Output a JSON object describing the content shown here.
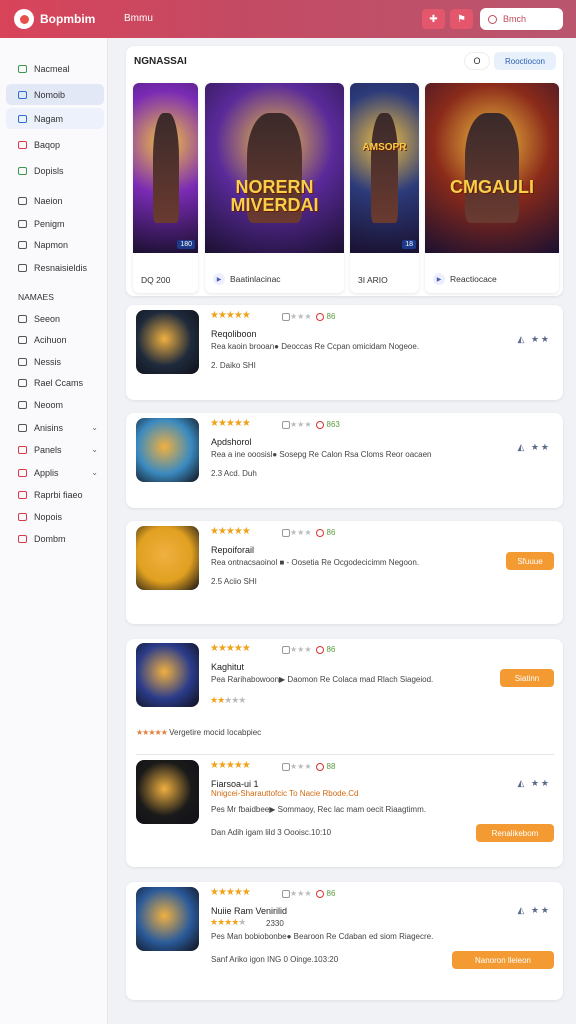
{
  "topbar": {
    "app_title": "Bopmbim",
    "nav_title": "Bmmu",
    "search_label": "Bmch",
    "logo_icon": "logo-icon",
    "btn1_icon": "gamepad-icon",
    "btn2_icon": "controller-icon"
  },
  "sidebar": {
    "items": [
      {
        "label": "Nacmeal",
        "icon": "grid-icon",
        "color": "#3a9a4a"
      },
      {
        "label": "Nomoib",
        "icon": "chart-icon",
        "color": "#2a6fd6",
        "state": "active"
      },
      {
        "label": "Nagam",
        "icon": "gamepad-icon",
        "color": "#2a6fd6",
        "state": "hl"
      },
      {
        "label": "Baqop",
        "icon": "tag-icon",
        "color": "#d83a4a"
      },
      {
        "label": "Dopisls",
        "icon": "star-icon",
        "color": "#3a9a4a"
      },
      {
        "label": "Naeion",
        "icon": "list-icon",
        "color": "#555"
      },
      {
        "label": "Penigm",
        "icon": "puzzle-icon",
        "color": "#555"
      },
      {
        "label": "Napmon",
        "icon": "box-icon",
        "color": "#555"
      },
      {
        "label": "Resnaisieldis",
        "icon": "cloud-icon",
        "color": "#555"
      }
    ],
    "group_label": "NAMAES",
    "group_items": [
      {
        "label": "Seeon",
        "icon": "calendar-icon",
        "color": "#555"
      },
      {
        "label": "Acihuon",
        "icon": "folder-icon",
        "color": "#555"
      },
      {
        "label": "Nessis",
        "icon": "chat-icon",
        "color": "#555"
      },
      {
        "label": "Rael Ccams",
        "icon": "doc-icon",
        "color": "#555"
      },
      {
        "label": "Neoom",
        "icon": "clock-icon",
        "color": "#555"
      },
      {
        "label": "Anisins",
        "icon": "people-icon",
        "color": "#555",
        "arrow": true
      },
      {
        "label": "Panels",
        "icon": "panel-icon",
        "color": "#d83a4a",
        "arrow": true
      },
      {
        "label": "Applis",
        "icon": "app-icon",
        "color": "#d83a4a",
        "arrow": true
      },
      {
        "label": "Raprbi fiaeo",
        "icon": "image-icon",
        "color": "#d83a4a"
      },
      {
        "label": "Nopois",
        "icon": "camera-icon",
        "color": "#d83a4a"
      },
      {
        "label": "Dombm",
        "icon": "link-icon",
        "color": "#d83a4a"
      }
    ]
  },
  "featured": {
    "title": "NGNASSAI",
    "view_all": "Rooctiocon",
    "circle_btn": "O",
    "cards": [
      {
        "caption": "DQ 200",
        "poster_text": "",
        "badge": "180",
        "bg": "#7a2bb5"
      },
      {
        "caption": "Baatinlacinac",
        "poster_text": "NORERN MIVERDAI",
        "badge": "",
        "bg": "#5a2a9a"
      },
      {
        "caption": "3I ARIO",
        "poster_text": "AMSOPR",
        "badge": "18",
        "bg": "#2c3b7a"
      },
      {
        "caption": "Reactiocace",
        "poster_text": "CMGAULI",
        "badge": "",
        "bg": "#8a2a1a"
      }
    ]
  },
  "apps": [
    {
      "name": "Reqoliboon",
      "desc": "Rea kaoin brooan● Deoccas Re Ccpan omicidam Nogeoe.",
      "meta": "2. Daiko SHI",
      "rating": 5,
      "count": "86",
      "action": "",
      "thumb_color": "#1e2a3c"
    },
    {
      "name": "Apdshorol",
      "desc": "Rea a ine ooosisl● Sosepg Re Calon Rsa Cloms Reor oacaen",
      "meta": "2.3 Acd. Duh",
      "rating": 5,
      "count": "863",
      "action": "",
      "thumb_color": "#3a8ac0"
    },
    {
      "name": "Repoiforail",
      "desc": "Rea ontnacsaoinol ■ - Oosetia Re Ocgodecicimm Negoon.",
      "meta": "2.5 Aciio SHI",
      "rating": 5,
      "count": "86",
      "action": "Sfuuue",
      "thumb_color": "#e0a020"
    },
    {
      "name": "Kaghitut",
      "desc": "Pea Rarihabowoon▶ Daomon Re Colaca mad Rlach Siageiod.",
      "meta": "",
      "rating": 5,
      "count": "86",
      "action": "Siatinn",
      "thumb_color": "#2a3b8a",
      "sub_rating": 2,
      "extra": "Vergetire mocid Iocabpiec"
    },
    {
      "name": "Fiarsoa-ui 1",
      "desc": "Pes Mr fbaidbee▶ Sommaoy, Rec lac mam oecit Riaagtimm.",
      "meta": "Dan Adih igam lild 3 Oooisc.10:10",
      "rating": 5,
      "count": "88",
      "action": "Renalikebom",
      "thumb_color": "#1a1a1a",
      "highlight": "Nnigcei-Sharauttofcic To Nacie Rbode.Cd"
    },
    {
      "name": "Nuiie Ram Venirilid",
      "desc": "Pes Man bobiobonbe● Bearoon Re Cdaban ed siom Riagecre.",
      "meta": "Sanf Ariko igon ING 0 Oinge.103:20",
      "rating": 5,
      "count": "86",
      "action": "Nanoron lleieon",
      "thumb_color": "#2a5a9a",
      "sub_rating": 4,
      "sub_text": "2330"
    }
  ]
}
